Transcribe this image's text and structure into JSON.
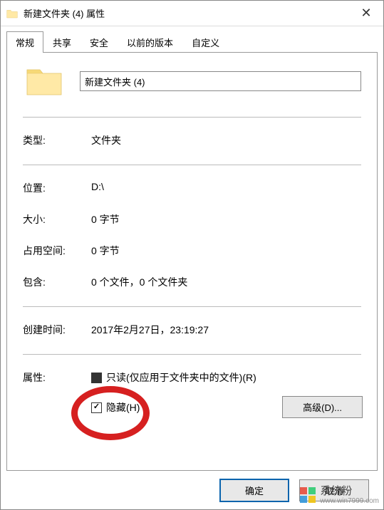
{
  "titlebar": {
    "title": "新建文件夹 (4) 属性"
  },
  "tabs": {
    "general": "常规",
    "share": "共享",
    "security": "安全",
    "previous_versions": "以前的版本",
    "customize": "自定义"
  },
  "folder": {
    "name_value": "新建文件夹 (4)"
  },
  "props": {
    "type_label": "类型:",
    "type_value": "文件夹",
    "location_label": "位置:",
    "location_value": "D:\\",
    "size_label": "大小:",
    "size_value": "0 字节",
    "size_on_disk_label": "占用空间:",
    "size_on_disk_value": "0 字节",
    "contains_label": "包含:",
    "contains_value": "0 个文件，0 个文件夹",
    "created_label": "创建时间:",
    "created_value": "2017年2月27日，23:19:27"
  },
  "attributes": {
    "label": "属性:",
    "readonly_label": "只读(仅应用于文件夹中的文件)(R)",
    "hidden_label": "隐藏(H)",
    "advanced_label": "高级(D)..."
  },
  "footer": {
    "ok": "确定",
    "cancel": "取消"
  },
  "watermark": {
    "brand": "系统粉",
    "url": "www.win7999.com"
  }
}
